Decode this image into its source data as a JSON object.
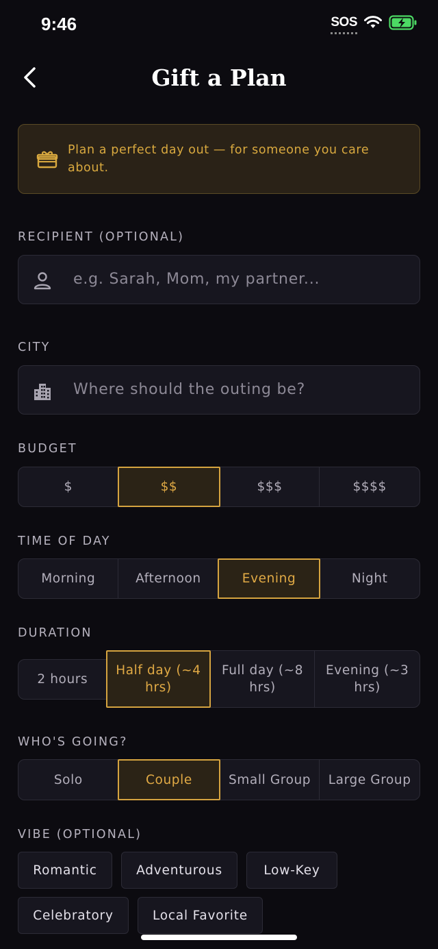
{
  "status": {
    "time": "9:46",
    "sos": "SOS"
  },
  "nav": {
    "title": "Gift a Plan"
  },
  "banner": {
    "text": "Plan a perfect day out — for someone you care about."
  },
  "recipient": {
    "label": "RECIPIENT (OPTIONAL)",
    "placeholder": "e.g. Sarah, Mom, my partner..."
  },
  "city": {
    "label": "CITY",
    "placeholder": "Where should the outing be?"
  },
  "budget": {
    "label": "BUDGET",
    "options": [
      "$",
      "$$",
      "$$$",
      "$$$$"
    ],
    "selected": "$$"
  },
  "time_of_day": {
    "label": "TIME OF DAY",
    "options": [
      "Morning",
      "Afternoon",
      "Evening",
      "Night"
    ],
    "selected": "Evening"
  },
  "duration": {
    "label": "DURATION",
    "options": [
      "2 hours",
      "Half day (~4 hrs)",
      "Full day (~8 hrs)",
      "Evening (~3 hrs)"
    ],
    "selected": "Half day (~4 hrs)"
  },
  "whos_going": {
    "label": "WHO'S GOING?",
    "options": [
      "Solo",
      "Couple",
      "Small Group",
      "Large Group"
    ],
    "selected": "Couple"
  },
  "vibe": {
    "label": "VIBE (OPTIONAL)",
    "chips": [
      "Romantic",
      "Adventurous",
      "Low-Key",
      "Celebratory",
      "Local Favorite"
    ]
  },
  "colors": {
    "accent": "#d6a440",
    "background": "#0c0b10",
    "field": "#17161f"
  },
  "icons": {
    "back": "chevron-left-icon",
    "banner": "gift-icon",
    "recipient": "person-icon",
    "city": "buildings-icon"
  }
}
